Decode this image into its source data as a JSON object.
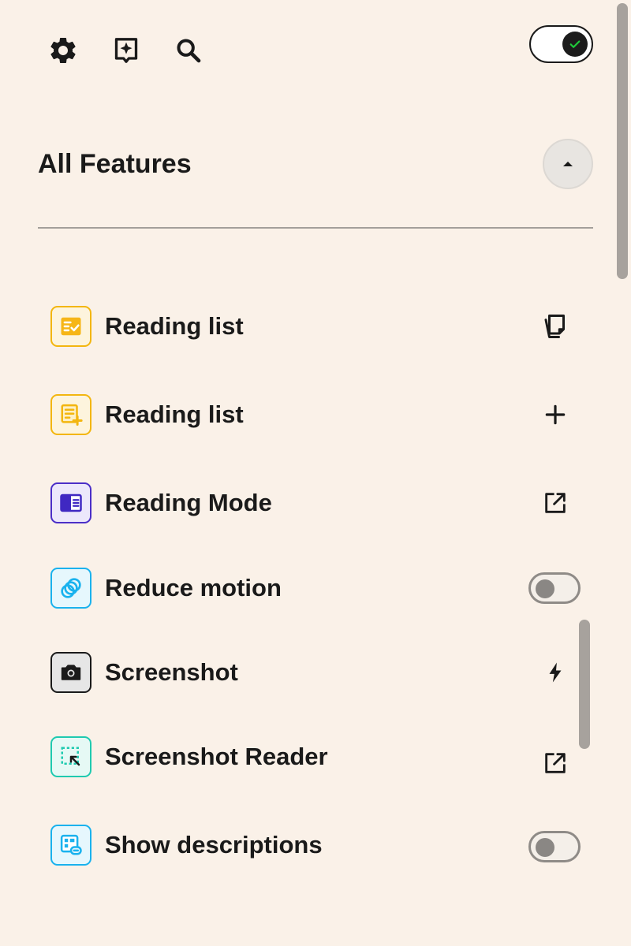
{
  "header": {
    "icons": [
      "gear-icon",
      "sparkle-tag-icon",
      "search-icon"
    ],
    "master_toggle": {
      "state": "on"
    }
  },
  "section": {
    "title": "All Features",
    "collapse_icon": "caret-up-icon"
  },
  "features": [
    {
      "label": "Reading list",
      "icon": "reading-list-check-icon",
      "icon_color": "#f3b60f",
      "icon_fill": "#f6b617",
      "action": "copy-icon"
    },
    {
      "label": "Reading list",
      "icon": "reading-list-add-icon",
      "icon_color": "#f3b60f",
      "icon_fill": "#fdf0c6",
      "action": "plus-icon"
    },
    {
      "label": "Reading Mode",
      "icon": "reading-mode-icon",
      "icon_color": "#4b2fc8",
      "icon_fill": "#3f28c2",
      "action": "external-link-icon"
    },
    {
      "label": "Reduce motion",
      "icon": "reduce-motion-icon",
      "icon_color": "#1ab2ee",
      "icon_fill": "#e2f6fd",
      "action": "toggle",
      "toggle_state": "off"
    },
    {
      "label": "Screenshot",
      "icon": "camera-icon",
      "icon_color": "#1a1a1a",
      "icon_fill": "#e6e6e6",
      "action": "lightning-icon"
    },
    {
      "label": "Screenshot Reader",
      "icon": "screenshot-reader-icon",
      "icon_color": "#1fcab0",
      "icon_fill": "#e2f8f3",
      "action": "external-link-icon"
    },
    {
      "label": "Show descriptions",
      "icon": "show-descriptions-icon",
      "icon_color": "#1ab2ee",
      "icon_fill": "#e2f6fd",
      "action": "toggle",
      "toggle_state": "off"
    }
  ],
  "colors": {
    "background": "#faf1e8",
    "text": "#1a1a1a",
    "divider": "#a39f9a",
    "toggle_check": "#1fc93a"
  }
}
